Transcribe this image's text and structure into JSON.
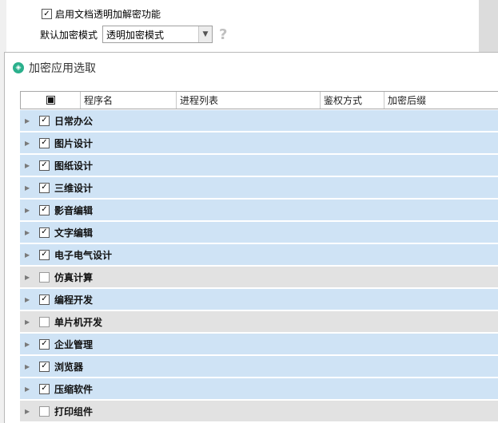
{
  "settings": {
    "enable_label": "启用文档透明加解密功能",
    "enable_checked": true,
    "mode_label": "默认加密模式",
    "mode_value": "透明加密模式",
    "help_glyph": "?"
  },
  "dialog": {
    "title": "加密应用选取",
    "columns": [
      "程序名",
      "进程列表",
      "鉴权方式",
      "加密后缀"
    ],
    "groups": [
      {
        "label": "日常办公",
        "checked": true
      },
      {
        "label": "图片设计",
        "checked": true
      },
      {
        "label": "图纸设计",
        "checked": true
      },
      {
        "label": "三维设计",
        "checked": true
      },
      {
        "label": "影音编辑",
        "checked": true
      },
      {
        "label": "文字编辑",
        "checked": true
      },
      {
        "label": "电子电气设计",
        "checked": true
      },
      {
        "label": "仿真计算",
        "checked": false
      },
      {
        "label": "编程开发",
        "checked": true
      },
      {
        "label": "单片机开发",
        "checked": false
      },
      {
        "label": "企业管理",
        "checked": true
      },
      {
        "label": "浏览器",
        "checked": true
      },
      {
        "label": "压缩软件",
        "checked": true
      },
      {
        "label": "打印组件",
        "checked": false
      }
    ]
  },
  "colors": {
    "checked_row": "#cfe3f5",
    "unchecked_row": "#e2e2e2",
    "accent": "#2bb08c"
  }
}
